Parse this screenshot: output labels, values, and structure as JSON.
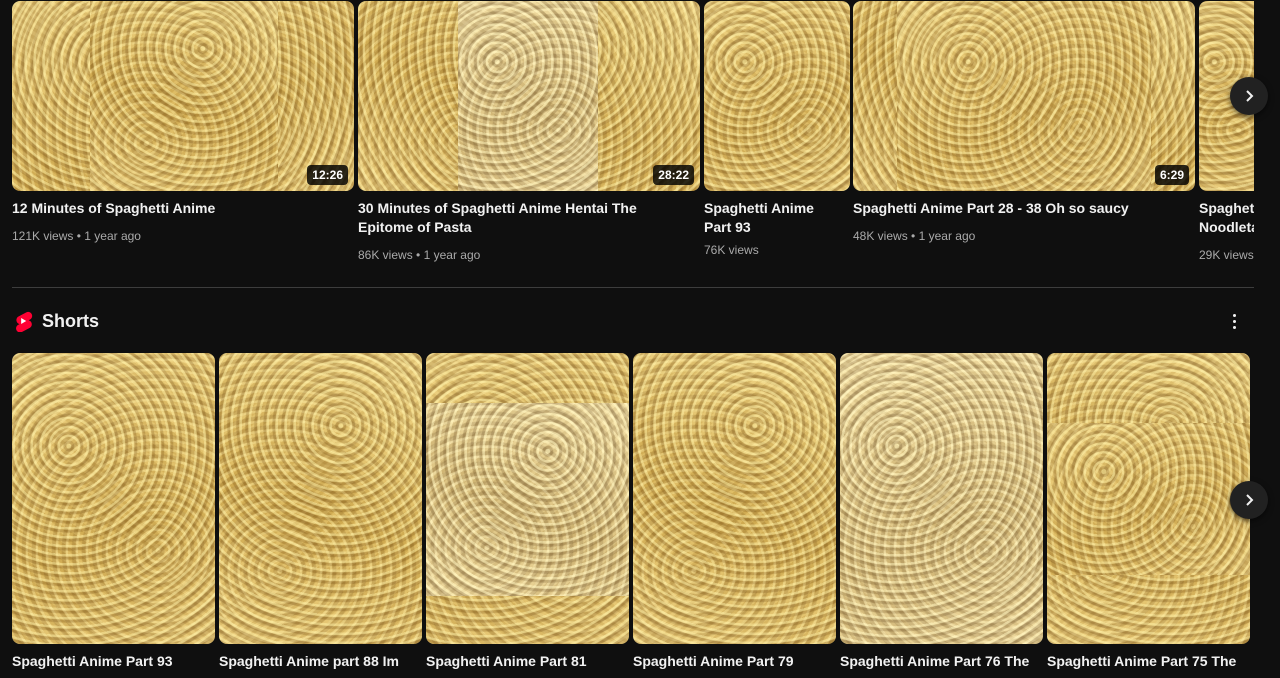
{
  "videos": [
    {
      "title": "12 Minutes of Spaghetti Anime",
      "views": "121K views",
      "age": "1 year ago",
      "duration": "12:26"
    },
    {
      "title": "30 Minutes of Spaghetti Anime Hentai The Epitome of Pasta",
      "views": "86K views",
      "age": "1 year ago",
      "duration": "28:22"
    },
    {
      "title": "Spaghetti Anime Part 93",
      "views": "76K views",
      "age": "",
      "duration": ""
    },
    {
      "title": "Spaghetti Anime Part 28 - 38 Oh so saucy",
      "views": "48K views",
      "age": "1 year ago",
      "duration": "6:29"
    },
    {
      "title": "Spaghett Noodleta",
      "views": "29K views",
      "age": "",
      "duration": ""
    }
  ],
  "shorts": {
    "title": "Shorts",
    "items": [
      {
        "title": "Spaghetti Anime Part 93"
      },
      {
        "title": "Spaghetti Anime part 88 Im"
      },
      {
        "title": "Spaghetti Anime Part 81"
      },
      {
        "title": "Spaghetti Anime Part 79"
      },
      {
        "title": "Spaghetti Anime Part 76 The"
      },
      {
        "title": "Spaghetti Anime Part 75 The"
      }
    ]
  },
  "separator": "•",
  "icons": {
    "next": "chevron-right-icon",
    "shorts_logo": "youtube-shorts-icon",
    "more": "more-vert-icon"
  },
  "colors": {
    "background": "#0f0f0f",
    "shorts_red": "#ff0033",
    "meta_text": "#aaaaaa"
  }
}
